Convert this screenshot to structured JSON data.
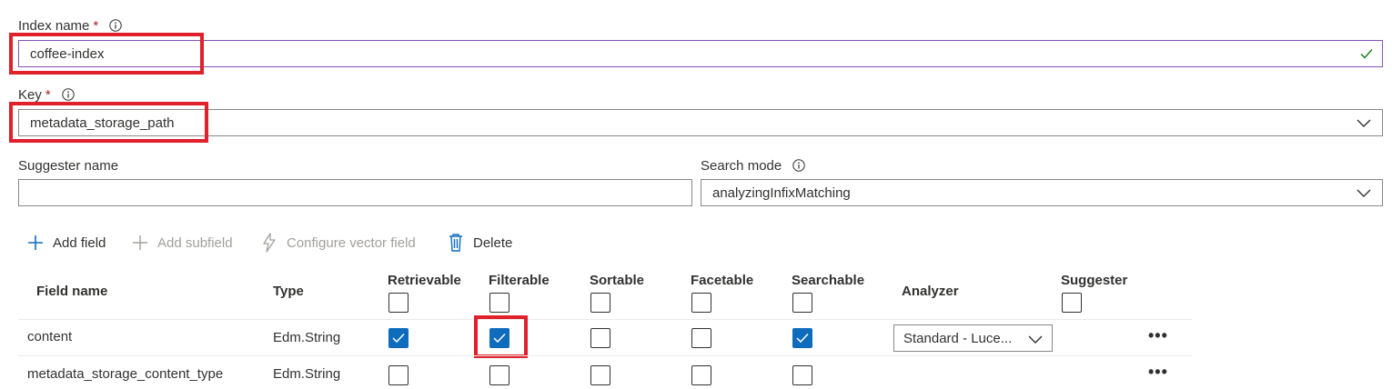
{
  "index_name": {
    "label": "Index name",
    "required_mark": "*",
    "value": "coffee-index"
  },
  "key": {
    "label": "Key",
    "required_mark": "*",
    "value": "metadata_storage_path"
  },
  "suggester_name": {
    "label": "Suggester name",
    "value": ""
  },
  "search_mode": {
    "label": "Search mode",
    "value": "analyzingInfixMatching"
  },
  "toolbar": {
    "add_field": "Add field",
    "add_subfield": "Add subfield",
    "configure_vector_field": "Configure vector field",
    "delete": "Delete"
  },
  "table": {
    "headers": {
      "field_name": "Field name",
      "type": "Type",
      "retrievable": "Retrievable",
      "filterable": "Filterable",
      "sortable": "Sortable",
      "facetable": "Facetable",
      "searchable": "Searchable",
      "analyzer": "Analyzer",
      "suggester": "Suggester"
    },
    "rows": [
      {
        "field_name": "content",
        "type": "Edm.String",
        "retrievable": true,
        "filterable": true,
        "sortable": false,
        "facetable": false,
        "searchable": true,
        "analyzer": "Standard - Luce...",
        "more": "•••"
      },
      {
        "field_name": "metadata_storage_content_type",
        "type": "Edm.String",
        "retrievable": false,
        "filterable": false,
        "sortable": false,
        "facetable": false,
        "searchable": false,
        "analyzer": "",
        "more": "•••"
      }
    ]
  },
  "colors": {
    "accent": "#0f6cbd",
    "highlight": "#e0202a",
    "valid": "#107c10",
    "focus": "#8a4fb5"
  }
}
